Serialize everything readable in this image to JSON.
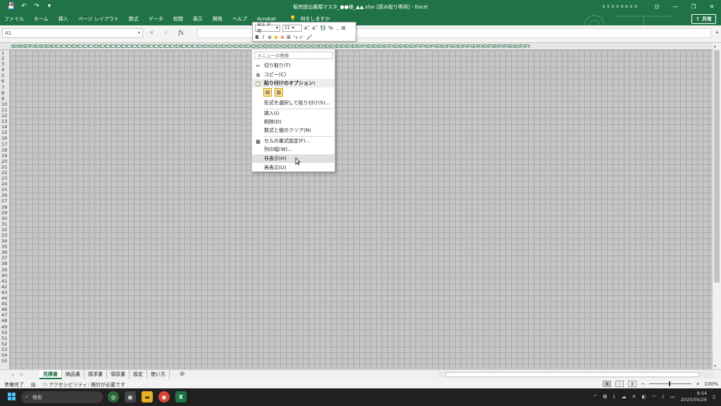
{
  "titlebar": {
    "doc_title": "販売提出書類マスタ_●●様_▲▲.xlsx [読み取り専用] - Excel",
    "user": "ｘｘｘｘｘｘｘｘ",
    "min": "—",
    "restore": "❐",
    "close": "✕",
    "ribbon_display": "⊡"
  },
  "qat": {
    "save": "💾",
    "undo": "↶",
    "redo": "↷",
    "more": "▾"
  },
  "ribbon": {
    "tabs": [
      "ファイル",
      "ホーム",
      "挿入",
      "ページ レイアウト",
      "数式",
      "データ",
      "校閲",
      "表示",
      "開発",
      "ヘルプ",
      "Acrobat"
    ],
    "tellme": "何をしますか",
    "share": "共有"
  },
  "formula": {
    "namebox": "A1",
    "cancel": "✕",
    "enter": "✓",
    "fx": "fx"
  },
  "columns_text": "XEXBXEXFXEXEXEXEXCXCXCXDXCXCXCXDXCXCXCXCXCXCXCXCXDXCXCXCXCXCXDXCXCXCXDXDXDXDXDXDXDXDXDXDXDXDXDXDXDXDXDXDXDXDXDXEXEXEXEXEXEXEXFXEXEXEXEXFXEXEXEXEXFXFXEXFXEXEXFXEXEXFXFXEXFXEXFXEXFXFXEXEXFXFX",
  "rows": [
    "1",
    "2",
    "3",
    "4",
    "5",
    "6",
    "7",
    "8",
    "9",
    "10",
    "11",
    "12",
    "13",
    "14",
    "15",
    "16",
    "17",
    "18",
    "19",
    "20",
    "21",
    "22",
    "23",
    "24",
    "25",
    "26",
    "27",
    "28",
    "29",
    "30",
    "31",
    "32",
    "33",
    "34",
    "35",
    "36",
    "37",
    "38",
    "39",
    "40",
    "41",
    "42",
    "43",
    "44",
    "45",
    "46",
    "47",
    "48",
    "49",
    "50",
    "51",
    "52",
    "53",
    "54",
    "55"
  ],
  "sheets": [
    "見積書",
    "納品書",
    "請求書",
    "領収書",
    "設定",
    "使い方"
  ],
  "active_sheet": 0,
  "status": {
    "ready": "準備完了",
    "accessibility": "アクセシビリティ: 検討が必要です",
    "zoom": "100%",
    "zoom_minus": "−",
    "zoom_plus": "+"
  },
  "minitoolbar": {
    "font": "ＭＳ Ｐ明",
    "size": "11",
    "bold": "B",
    "italic": "I",
    "percent": "%",
    "comma": ","
  },
  "context_menu": {
    "search_placeholder": "メニューの検索",
    "cut": "切り取り(T)",
    "copy": "コピー(C)",
    "paste_header": "貼り付けのオプション:",
    "paste_special": "形式を選択して貼り付け(S)...",
    "insert": "挿入(I)",
    "delete": "削除(D)",
    "clear": "数式と値のクリア(N)",
    "format_cells": "セルの書式設定(F)...",
    "column_width": "列の幅(W)...",
    "hide": "非表示(H)",
    "unhide": "再表示(U)"
  },
  "taskbar": {
    "search": "検索",
    "time": "9:54",
    "date": "2025/05/26"
  }
}
